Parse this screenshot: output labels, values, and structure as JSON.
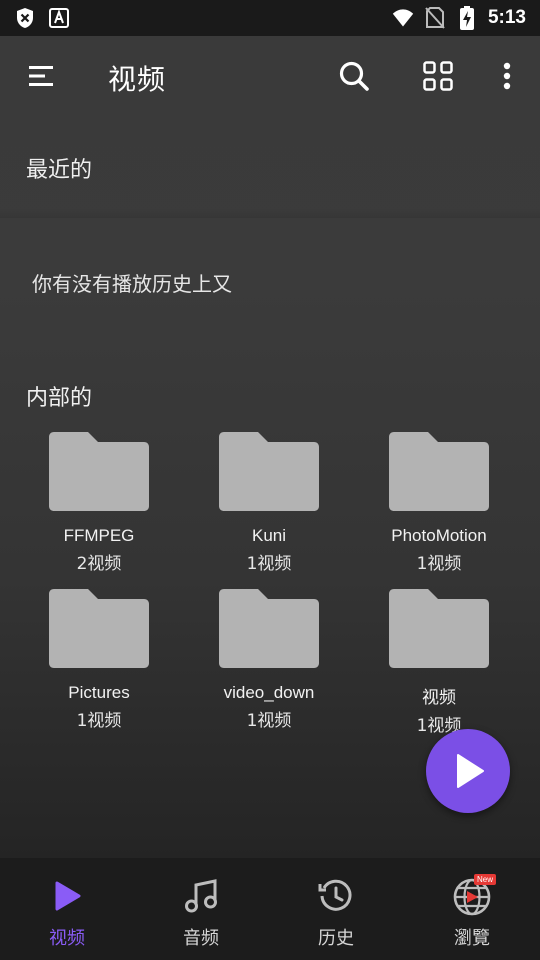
{
  "status_bar": {
    "time": "5:13",
    "icons": [
      "shield-x-icon",
      "text-a-icon",
      "wifi-icon",
      "no-sim-icon",
      "battery-charging-icon"
    ]
  },
  "toolbar": {
    "title": "视频",
    "icons": [
      "menu-icon",
      "search-icon",
      "grid-view-icon",
      "more-vert-icon"
    ]
  },
  "recent": {
    "title": "最近的",
    "empty_message": "你有没有播放历史上又"
  },
  "internal": {
    "title": "内部的",
    "folders": [
      {
        "name": "FFMPEG",
        "count": "2视频"
      },
      {
        "name": "Kuni",
        "count": "1视频"
      },
      {
        "name": "PhotoMotion",
        "count": "1视频"
      },
      {
        "name": "Pictures",
        "count": "1视频"
      },
      {
        "name": "video_down",
        "count": "1视频"
      },
      {
        "name": "视频",
        "count": "1视频"
      }
    ]
  },
  "fab": {
    "icon": "play-icon"
  },
  "bottom_nav": {
    "items": [
      {
        "label": "视频",
        "icon": "play-icon",
        "active": true
      },
      {
        "label": "音频",
        "icon": "music-note-icon",
        "active": false
      },
      {
        "label": "历史",
        "icon": "history-icon",
        "active": false
      },
      {
        "label": "瀏覽",
        "icon": "globe-play-icon",
        "active": false,
        "badge": "New"
      }
    ]
  },
  "colors": {
    "accent": "#7b4fe6",
    "active_tab": "#8a5cf6",
    "folder": "#b3b3b3",
    "background": "#3a3a3a"
  }
}
